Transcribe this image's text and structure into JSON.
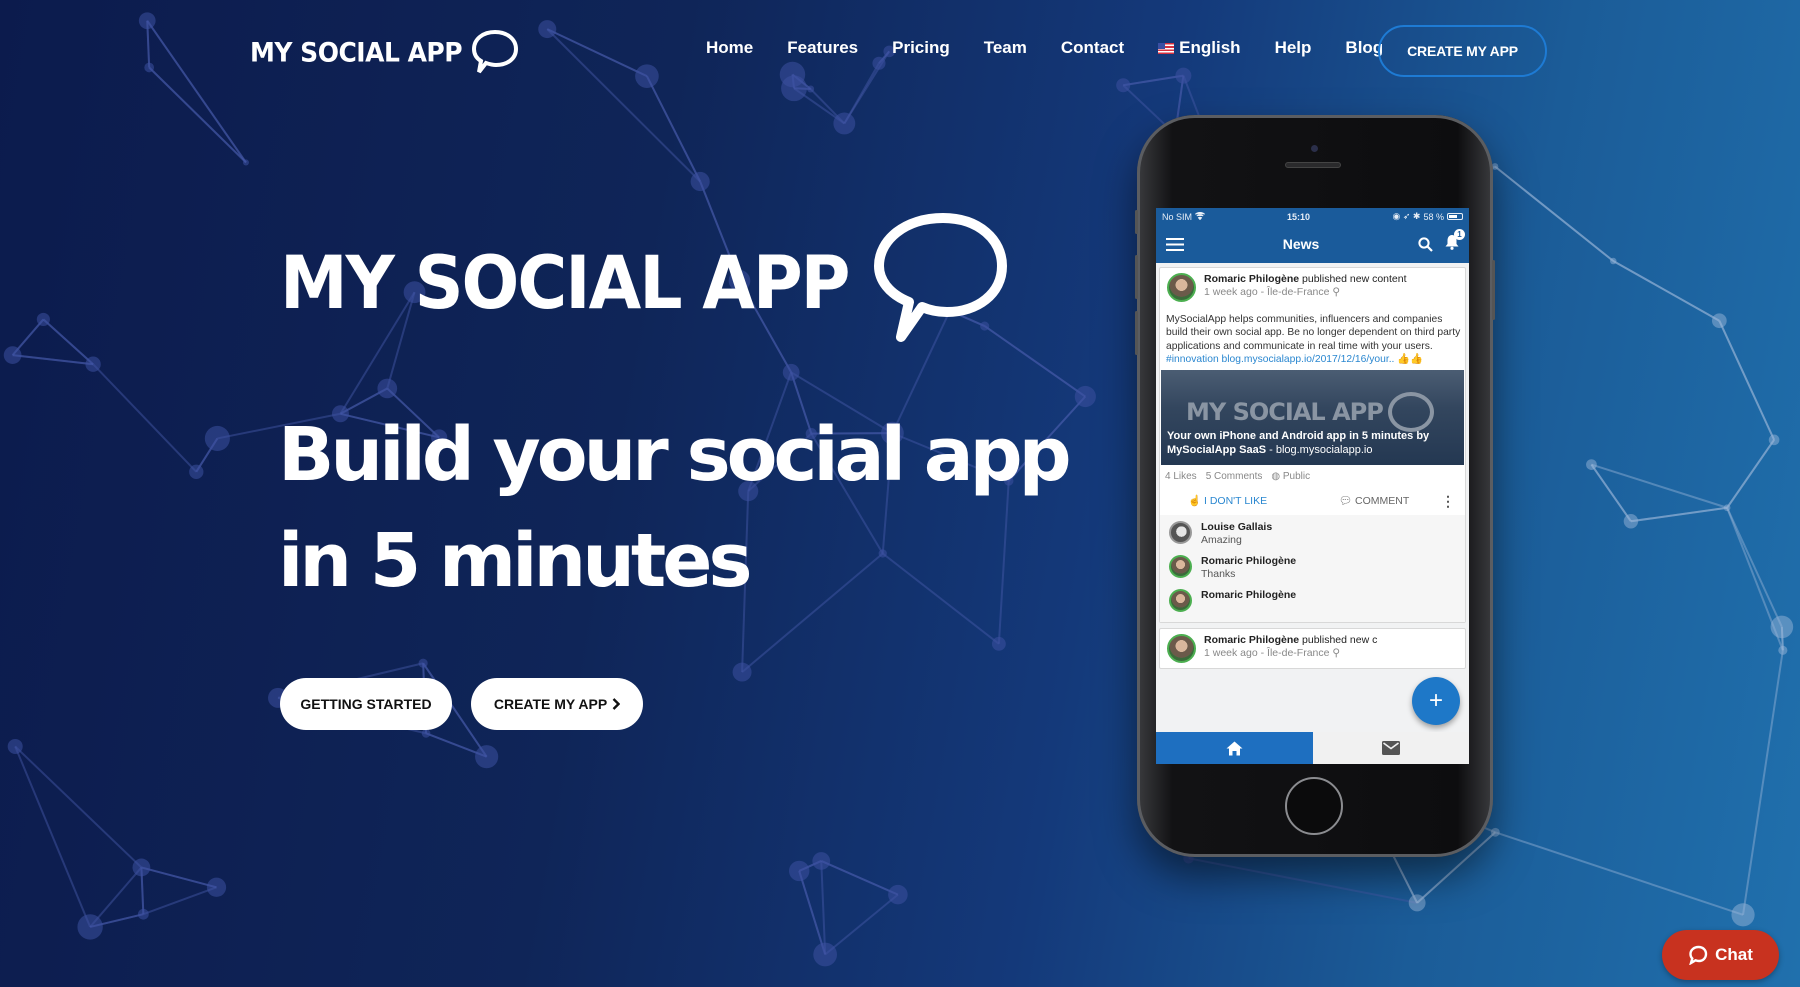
{
  "brand": {
    "name": "MY SOCIAL APP",
    "colors": {
      "background_left": "#0c1b4d",
      "background_right": "#2070ad",
      "primary_blue": "#1e78c8",
      "cta_border": "#1e7bd4",
      "chat_red": "#c8321f"
    }
  },
  "header": {
    "logo_text": "MY SOCIAL APP",
    "logo_icon": "speech-bubble-icon",
    "nav": [
      {
        "label": "Home"
      },
      {
        "label": "Features"
      },
      {
        "label": "Pricing"
      },
      {
        "label": "Team"
      },
      {
        "label": "Contact"
      },
      {
        "label": "English",
        "icon": "us-flag-icon"
      },
      {
        "label": "Help"
      },
      {
        "label": "Blog"
      }
    ],
    "cta_label": "CREATE MY APP"
  },
  "hero": {
    "logo_text": "MY SOCIAL APP",
    "headline_line1": "Build your social app",
    "headline_line2": "in 5 minutes",
    "buttons": {
      "getting_started": "GETTING STARTED",
      "create_my_app": "CREATE MY APP",
      "create_icon": "chevron-right-icon"
    }
  },
  "phone": {
    "status_bar": {
      "carrier": "No SIM",
      "time": "15:10",
      "battery": "58 %"
    },
    "app_bar": {
      "title": "News",
      "notification_count": "1"
    },
    "post": {
      "author": "Romaric Philogène",
      "action": "published new content",
      "meta": "1 week ago - Île-de-France",
      "text": "MySocialApp helps communities, influencers and companies build their own social app. Be no longer dependent on third party applications and communicate in real time with your users.",
      "hashtag": "#innovation",
      "link": "blog.mysocialapp.io/2017/12/16/your..",
      "emoji": "👍👍",
      "image": {
        "overlay_title": "MY SOCIAL APP",
        "caption_bold": "Your own iPhone and Android app in 5 minutes by MySocialApp SaaS",
        "caption_link": " - blog.mysocialapp.io"
      },
      "likes": "4 Likes",
      "comments_count": "5 Comments",
      "visibility": "Public",
      "dislike_label": "I DON'T LIKE",
      "comment_label": "COMMENT"
    },
    "comments": [
      {
        "author": "Louise Gallais",
        "text": "Amazing"
      },
      {
        "author": "Romaric Philogène",
        "text": "Thanks"
      },
      {
        "author": "Romaric Philogène",
        "text": ""
      }
    ],
    "next_post": {
      "author": "Romaric Philogène",
      "action": "published new c",
      "meta": "1 week ago - Île-de-France"
    },
    "fab_label": "+"
  },
  "chat": {
    "label": "Chat"
  }
}
